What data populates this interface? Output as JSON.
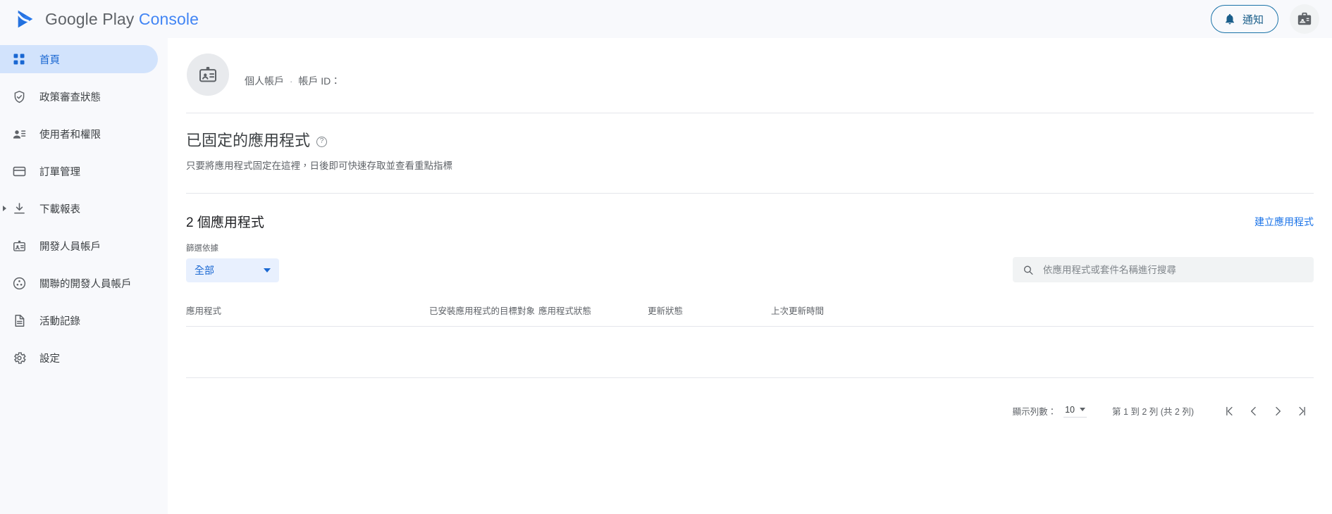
{
  "topbar": {
    "brand_google_play": "Google Play",
    "brand_console": "Console",
    "notifications_label": "通知",
    "notifications_icon": "bell-icon",
    "account_icon": "badge-icon"
  },
  "sidebar": {
    "items": [
      {
        "label": "首頁",
        "icon": "grid-icon",
        "active": true,
        "expandable": false
      },
      {
        "label": "政策審查狀態",
        "icon": "shield-check-icon",
        "active": false,
        "expandable": false
      },
      {
        "label": "使用者和權限",
        "icon": "person-list-icon",
        "active": false,
        "expandable": false
      },
      {
        "label": "訂單管理",
        "icon": "credit-card-icon",
        "active": false,
        "expandable": false
      },
      {
        "label": "下載報表",
        "icon": "download-icon",
        "active": false,
        "expandable": true
      },
      {
        "label": "開發人員帳戶",
        "icon": "badge-icon",
        "active": false,
        "expandable": false
      },
      {
        "label": "關聯的開發人員帳戶",
        "icon": "linked-accounts-icon",
        "active": false,
        "expandable": false
      },
      {
        "label": "活動記錄",
        "icon": "document-icon",
        "active": false,
        "expandable": false
      },
      {
        "label": "設定",
        "icon": "gear-icon",
        "active": false,
        "expandable": false
      }
    ]
  },
  "account": {
    "avatar_icon": "badge-icon",
    "type": "個人帳戶",
    "separator": "·",
    "id_label": "帳戶 ID：",
    "id_value": ""
  },
  "pinned": {
    "title": "已固定的應用程式",
    "help_icon": "help-icon",
    "help_glyph": "?",
    "description": "只要將應用程式固定在這裡，日後即可快速存取並查看重點指標"
  },
  "apps_section": {
    "count_title": "2 個應用程式",
    "create_link": "建立應用程式",
    "filter_label": "篩選依據",
    "filter_value": "全部",
    "search_placeholder": "依應用程式或套件名稱進行搜尋",
    "search_value": "",
    "search_icon": "search-icon",
    "columns": [
      "應用程式",
      "已安裝應用程式的目標對象",
      "應用程式狀態",
      "更新狀態",
      "上次更新時間"
    ],
    "rows": []
  },
  "pagination": {
    "rows_label": "顯示列數：",
    "rows_per_page": "10",
    "range_text": "第 1 到 2 列 (共 2 列)",
    "first_icon": "first-page-icon",
    "prev_icon": "chevron-left-icon",
    "next_icon": "chevron-right-icon",
    "last_icon": "last-page-icon"
  },
  "colors": {
    "accent_blue": "#1a73e8",
    "active_nav_bg": "#d2e3fc",
    "active_nav_text": "#1967d2",
    "chip_bg": "#e8f0fe",
    "sidebar_bg": "#f8f9fc",
    "text_primary": "#202124",
    "text_secondary": "#5f6368"
  }
}
